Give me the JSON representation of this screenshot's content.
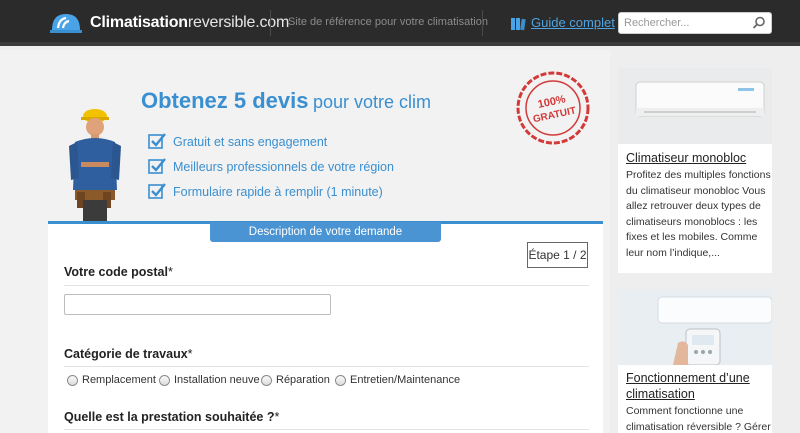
{
  "header": {
    "logo_bold": "Climatisation",
    "logo_light": "reversible",
    "logo_suffix": ".com",
    "tagline": "Site de référence pour votre climatisation",
    "guide_label": "Guide complet",
    "search_placeholder": "Rechercher...",
    "icons": [
      "helmet-logo-icon",
      "book-icon",
      "search-icon"
    ]
  },
  "hero": {
    "title_bold": "Obtenez 5 devis",
    "title_rest": "pour votre clim",
    "benefits": [
      "Gratuit et sans engagement",
      "Meilleurs professionnels de votre région",
      "Formulaire rapide à remplir (1 minute)"
    ],
    "stamp_text": "100% GRATUIT",
    "colors": {
      "accent": "#3a8fd0",
      "stamp": "#d23a3a"
    }
  },
  "form": {
    "tab_label": "Description de votre demande",
    "step_label": "Étape 1 / 2",
    "postal_label": "Votre code postal",
    "postal_value": "",
    "category_label": "Catégorie de travaux",
    "category_options": [
      "Remplacement",
      "Installation neuve",
      "Réparation",
      "Entretien/Maintenance"
    ],
    "service_label": "Quelle est la prestation souhaitée ?",
    "required_mark": "*"
  },
  "sidebar": {
    "cards": [
      {
        "title": "Climatiseur monobloc",
        "text": "Profitez des multiples fonctions du climatiseur monobloc Vous allez retrouver deux types de climatiseurs monoblocs : les fixes et les mobiles. Comme leur nom l’indique,..."
      },
      {
        "title": "Fonctionnement d’une climatisation",
        "text": "Comment fonctionne une climatisation réversible ? Gérer"
      }
    ]
  }
}
